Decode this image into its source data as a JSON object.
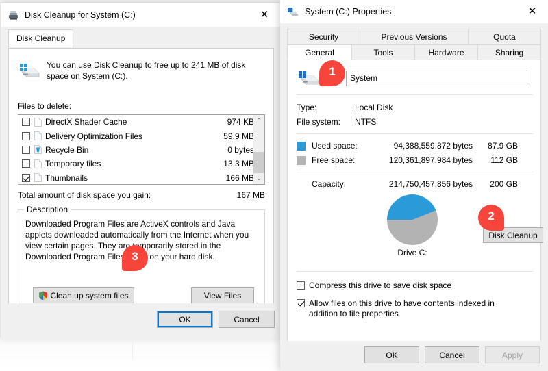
{
  "cleanup_window": {
    "title": "Disk Cleanup for System (C:)",
    "title_icon": "disk-cleanup-icon",
    "close_label": "✕",
    "tab_label": "Disk Cleanup",
    "intro_text": "You can use Disk Cleanup to free up to 241 MB of disk space on System (C:).",
    "files_to_delete_label": "Files to delete:",
    "file_list": [
      {
        "name": "DirectX Shader Cache",
        "size": "974 KB",
        "checked": false,
        "icon": "file-icon"
      },
      {
        "name": "Delivery Optimization Files",
        "size": "59.9 MB",
        "checked": false,
        "icon": "file-icon"
      },
      {
        "name": "Recycle Bin",
        "size": "0 bytes",
        "checked": false,
        "icon": "recycle-bin-icon"
      },
      {
        "name": "Temporary files",
        "size": "13.3 MB",
        "checked": false,
        "icon": "file-icon"
      },
      {
        "name": "Thumbnails",
        "size": "166 MB",
        "checked": true,
        "icon": "file-icon"
      }
    ],
    "scroll_up_glyph": "⌃",
    "scroll_down_glyph": "⌄",
    "total_label": "Total amount of disk space you gain:",
    "total_value": "167 MB",
    "description_legend": "Description",
    "description_text": "Downloaded Program Files are ActiveX controls and Java applets downloaded automatically from the Internet when you view certain pages. They are temporarily stored in the Downloaded Program Files folder on your hard disk.",
    "clean_system_files_label": "Clean up system files",
    "view_files_label": "View Files",
    "ok_label": "OK",
    "cancel_label": "Cancel"
  },
  "properties_window": {
    "title": "System (C:) Properties",
    "title_icon": "drive-properties-icon",
    "close_label": "✕",
    "tabs_row1": [
      {
        "label": "Security",
        "active": false
      },
      {
        "label": "Previous Versions",
        "active": false
      },
      {
        "label": "Quota",
        "active": false
      }
    ],
    "tabs_row2": [
      {
        "label": "General",
        "active": true
      },
      {
        "label": "Tools",
        "active": false
      },
      {
        "label": "Hardware",
        "active": false
      },
      {
        "label": "Sharing",
        "active": false
      }
    ],
    "volume_label_value": "System",
    "type_label": "Type:",
    "type_value": "Local Disk",
    "filesystem_label": "File system:",
    "filesystem_value": "NTFS",
    "used_space_label": "Used space:",
    "used_space_bytes": "94,388,559,872 bytes",
    "used_space_gb": "87.9 GB",
    "free_space_label": "Free space:",
    "free_space_bytes": "120,361,897,984 bytes",
    "free_space_gb": "112 GB",
    "capacity_label": "Capacity:",
    "capacity_bytes": "214,750,457,856 bytes",
    "capacity_gb": "200 GB",
    "drive_caption": "Drive C:",
    "disk_cleanup_label": "Disk Cleanup",
    "compress_label": "Compress this drive to save disk space",
    "compress_checked": false,
    "index_label": "Allow files on this drive to have contents indexed in addition to file properties",
    "index_checked": true,
    "ok_label": "OK",
    "cancel_label": "Cancel",
    "apply_label": "Apply",
    "apply_disabled": true
  },
  "markers": [
    {
      "number": "1"
    },
    {
      "number": "2"
    },
    {
      "number": "3"
    }
  ],
  "colors": {
    "used_space": "#2b9ad8",
    "free_space": "#b3b3b3",
    "marker_red": "#f7453c",
    "focus_blue": "#0078d7"
  },
  "chart_data": {
    "type": "pie",
    "title": "Drive C:",
    "labels": [
      "Used space",
      "Free space"
    ],
    "values": [
      94388559872,
      120361897984
    ],
    "value_labels": [
      "87.9 GB",
      "112 GB"
    ],
    "percentages": [
      44,
      56
    ],
    "colors": [
      "#2b9ad8",
      "#b3b3b3"
    ],
    "legend": "left",
    "donut": true
  }
}
